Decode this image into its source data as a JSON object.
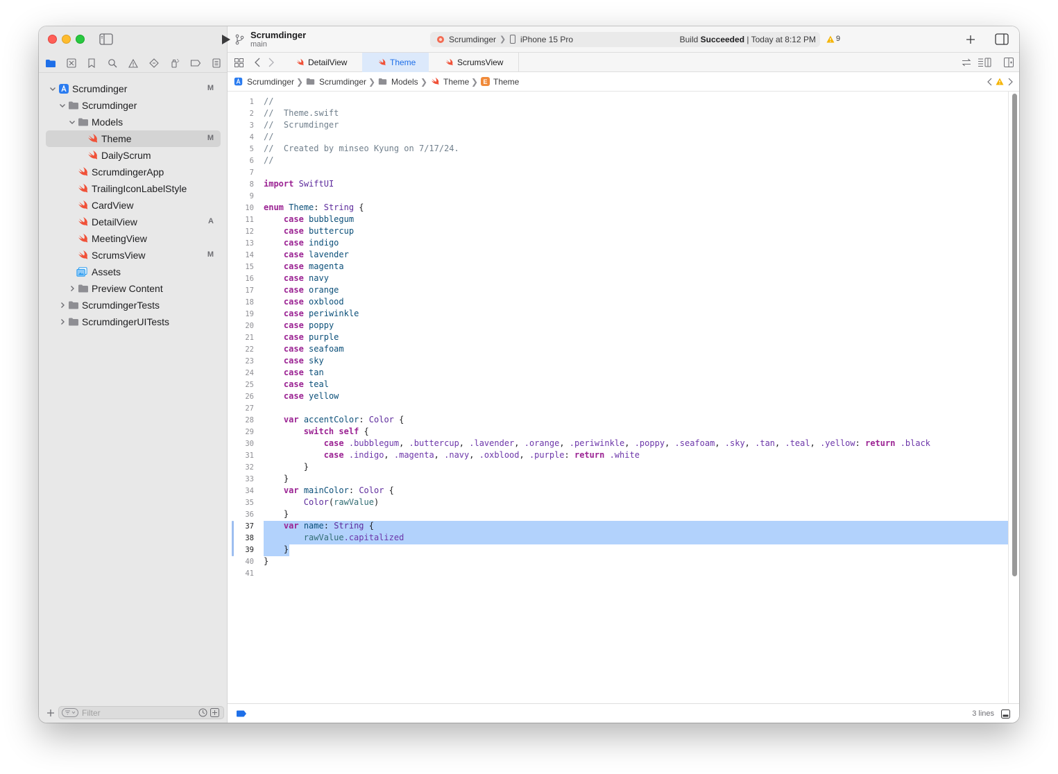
{
  "project": {
    "name": "Scrumdinger",
    "branch": "main"
  },
  "status": {
    "scheme": "Scrumdinger",
    "device": "iPhone 15 Pro",
    "build_prefix": "Build ",
    "build_result": "Succeeded",
    "build_time": " | Today at 8:12 PM",
    "warnings": "9"
  },
  "tabs": [
    {
      "label": "DetailView"
    },
    {
      "label": "Theme"
    },
    {
      "label": "ScrumsView"
    }
  ],
  "breadcrumb": [
    "Scrumdinger",
    "Scrumdinger",
    "Models",
    "Theme",
    "Theme"
  ],
  "navigator": {
    "items": [
      {
        "label": "Scrumdinger",
        "badge": "M"
      },
      {
        "label": "Scrumdinger",
        "badge": ""
      },
      {
        "label": "Models",
        "badge": ""
      },
      {
        "label": "Theme",
        "badge": "M"
      },
      {
        "label": "DailyScrum",
        "badge": ""
      },
      {
        "label": "ScrumdingerApp",
        "badge": ""
      },
      {
        "label": "TrailingIconLabelStyle",
        "badge": ""
      },
      {
        "label": "CardView",
        "badge": ""
      },
      {
        "label": "DetailView",
        "badge": "A"
      },
      {
        "label": "MeetingView",
        "badge": ""
      },
      {
        "label": "ScrumsView",
        "badge": "M"
      },
      {
        "label": "Assets",
        "badge": ""
      },
      {
        "label": "Preview Content",
        "badge": ""
      },
      {
        "label": "ScrumdingerTests",
        "badge": ""
      },
      {
        "label": "ScrumdingerUITests",
        "badge": ""
      }
    ],
    "filter_placeholder": "Filter"
  },
  "editor": {
    "lines": [
      "//",
      "//  Theme.swift",
      "//  Scrumdinger",
      "//",
      "//  Created by minseo Kyung on 7/17/24.",
      "//",
      "",
      "import SwiftUI",
      "",
      "enum Theme: String {",
      "    case bubblegum",
      "    case buttercup",
      "    case indigo",
      "    case lavender",
      "    case magenta",
      "    case navy",
      "    case orange",
      "    case oxblood",
      "    case periwinkle",
      "    case poppy",
      "    case purple",
      "    case seafoam",
      "    case sky",
      "    case tan",
      "    case teal",
      "    case yellow",
      "",
      "    var accentColor: Color {",
      "        switch self {",
      "            case .bubblegum, .buttercup, .lavender, .orange, .periwinkle, .poppy, .seafoam, .sky, .tan, .teal, .yellow: return .black",
      "            case .indigo, .magenta, .navy, .oxblood, .purple: return .white",
      "        }",
      "    }",
      "    var mainColor: Color {",
      "        Color(rawValue)",
      "    }",
      "    var name: String {",
      "        rawValue.capitalized",
      "    }",
      "}",
      ""
    ],
    "selected_lines": [
      37,
      38,
      39
    ],
    "selection_info": "3 lines"
  },
  "colors": {
    "accent": "#1e6fe8",
    "swift_orange": "#f05138",
    "selection": "#b2d2fc",
    "keyword": "#9b2393",
    "comment": "#707f8c"
  }
}
